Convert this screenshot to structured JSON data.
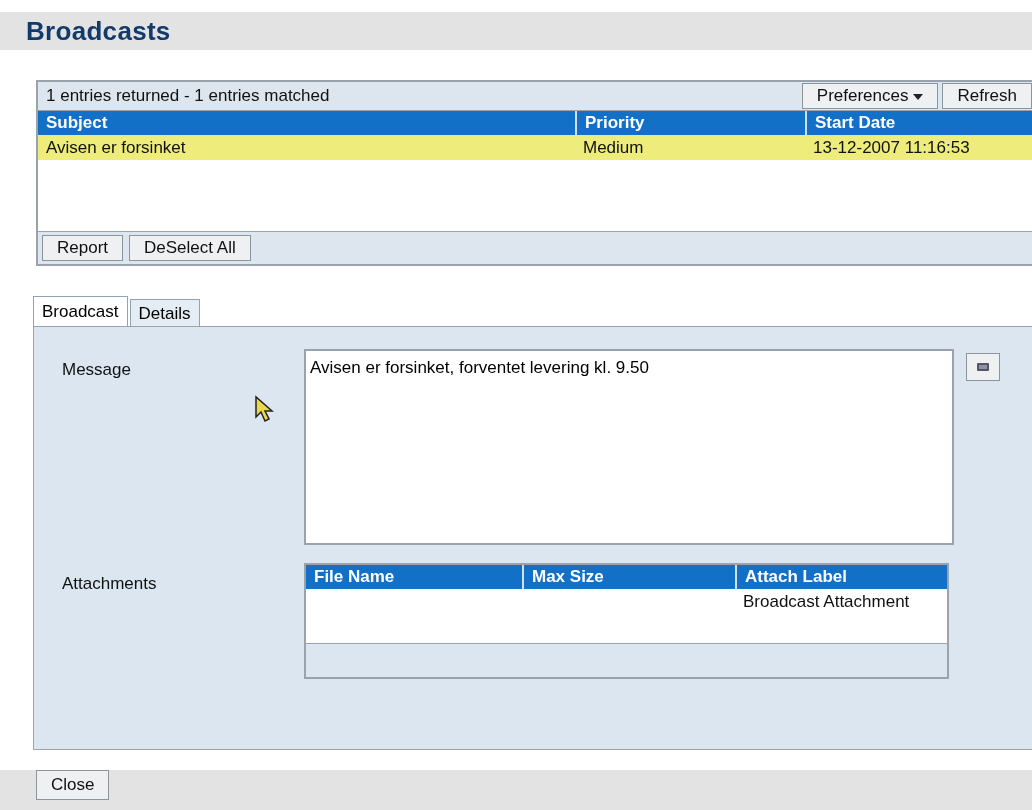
{
  "title": "Broadcasts",
  "results": {
    "summary": "1 entries returned - 1 entries matched",
    "toolbar_buttons": [
      {
        "label": "Preferences",
        "kind": "dropdown"
      },
      {
        "label": "Refresh",
        "kind": "plain"
      }
    ],
    "columns": [
      "Subject",
      "Priority",
      "Start Date"
    ],
    "rows": [
      {
        "cells": [
          "Avisen er forsinket",
          "Medium",
          "13-12-2007 11:16:53"
        ],
        "selected": true
      }
    ],
    "footer_buttons": [
      "Report",
      "DeSelect All"
    ]
  },
  "tabs": [
    {
      "label": "Broadcast",
      "selected": true
    },
    {
      "label": "Details",
      "selected": false
    }
  ],
  "message": {
    "label": "Message",
    "value": "Avisen er forsinket, forventet levering kl. 9.50"
  },
  "attachments": {
    "label": "Attachments",
    "columns": [
      "File Name",
      "Max Size",
      "Attach Label"
    ],
    "rows": [
      {
        "cells": [
          "",
          "",
          "Broadcast Attachment"
        ]
      }
    ]
  },
  "buttons": [
    "Close"
  ]
}
